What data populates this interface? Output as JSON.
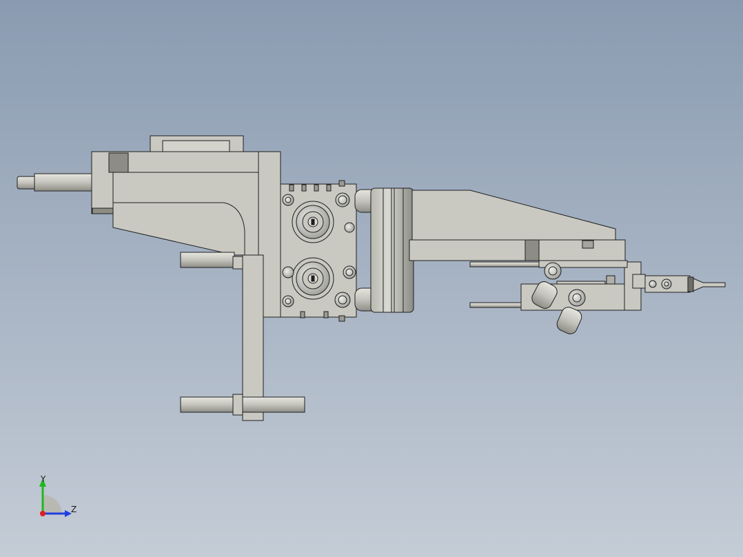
{
  "viewport": {
    "background_top": "#8a9bb1",
    "background_bottom": "#c4ccd6",
    "part_fill": "#c9c9c2",
    "edge_color": "#1e1e1e"
  },
  "triad": {
    "y_label": "Y",
    "z_label": "Z",
    "y_color": "#1fb81f",
    "z_color": "#1f3fe0",
    "x_color": "#e01f1f"
  }
}
